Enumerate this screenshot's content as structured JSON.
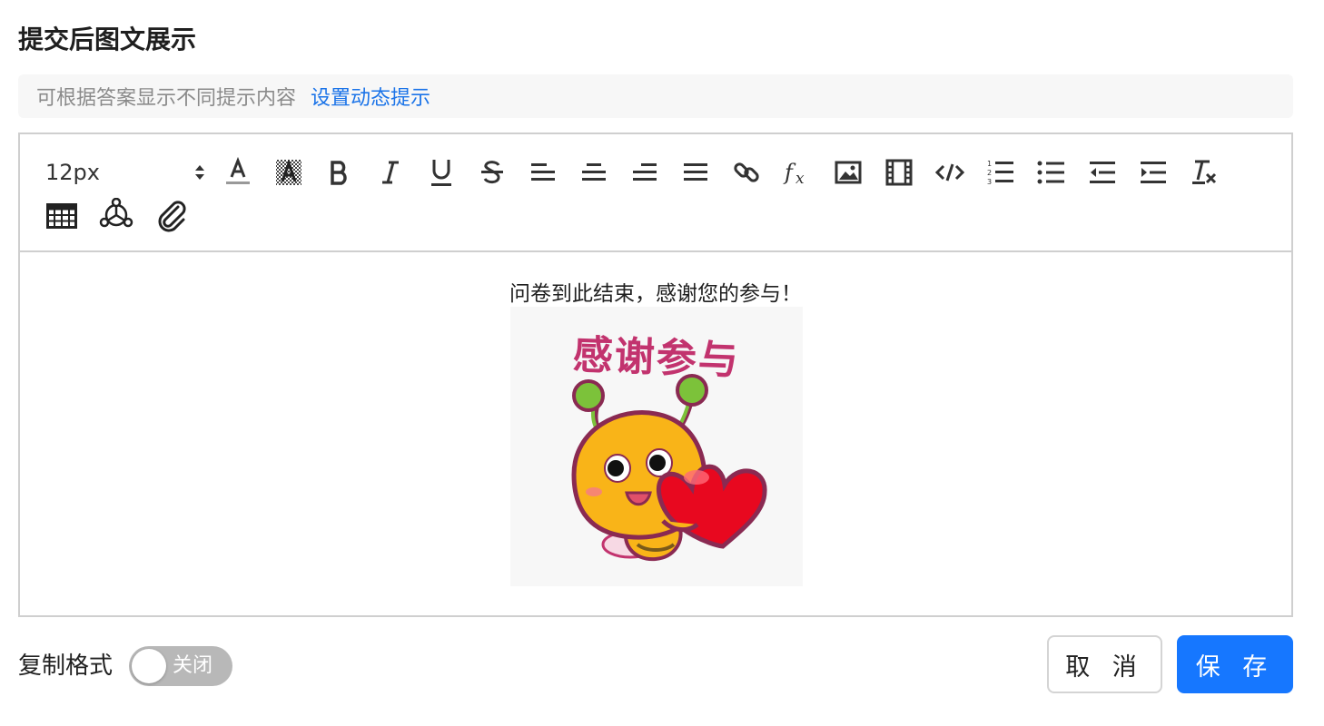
{
  "header": {
    "title": "提交后图文展示"
  },
  "hint": {
    "text": "可根据答案显示不同提示内容",
    "link": "设置动态提示"
  },
  "toolbar": {
    "font_size": "12px",
    "buttons": [
      "font-color-icon",
      "background-color-icon",
      "bold-icon",
      "italic-icon",
      "underline-icon",
      "strikethrough-icon",
      "align-left-icon",
      "align-center-icon",
      "align-right-icon",
      "align-justify-icon",
      "link-icon",
      "formula-icon",
      "image-icon",
      "video-icon",
      "code-icon",
      "ordered-list-icon",
      "bullet-list-icon",
      "outdent-icon",
      "indent-icon",
      "clear-format-icon",
      "table-icon",
      "mind-map-icon",
      "attachment-icon"
    ]
  },
  "content": {
    "message": "问卷到此结束，感谢您的参与！",
    "sticker_caption": "感谢参与"
  },
  "footer": {
    "copy_format_label": "复制格式",
    "toggle_state": "关闭",
    "cancel_label": "取 消",
    "save_label": "保 存"
  },
  "colors": {
    "accent": "#1677ff",
    "link": "#1a73e8",
    "toggle_off": "#b8b8b8",
    "sticker_text": "#c2336e",
    "heart": "#e8081f",
    "bee": "#f9b418"
  }
}
